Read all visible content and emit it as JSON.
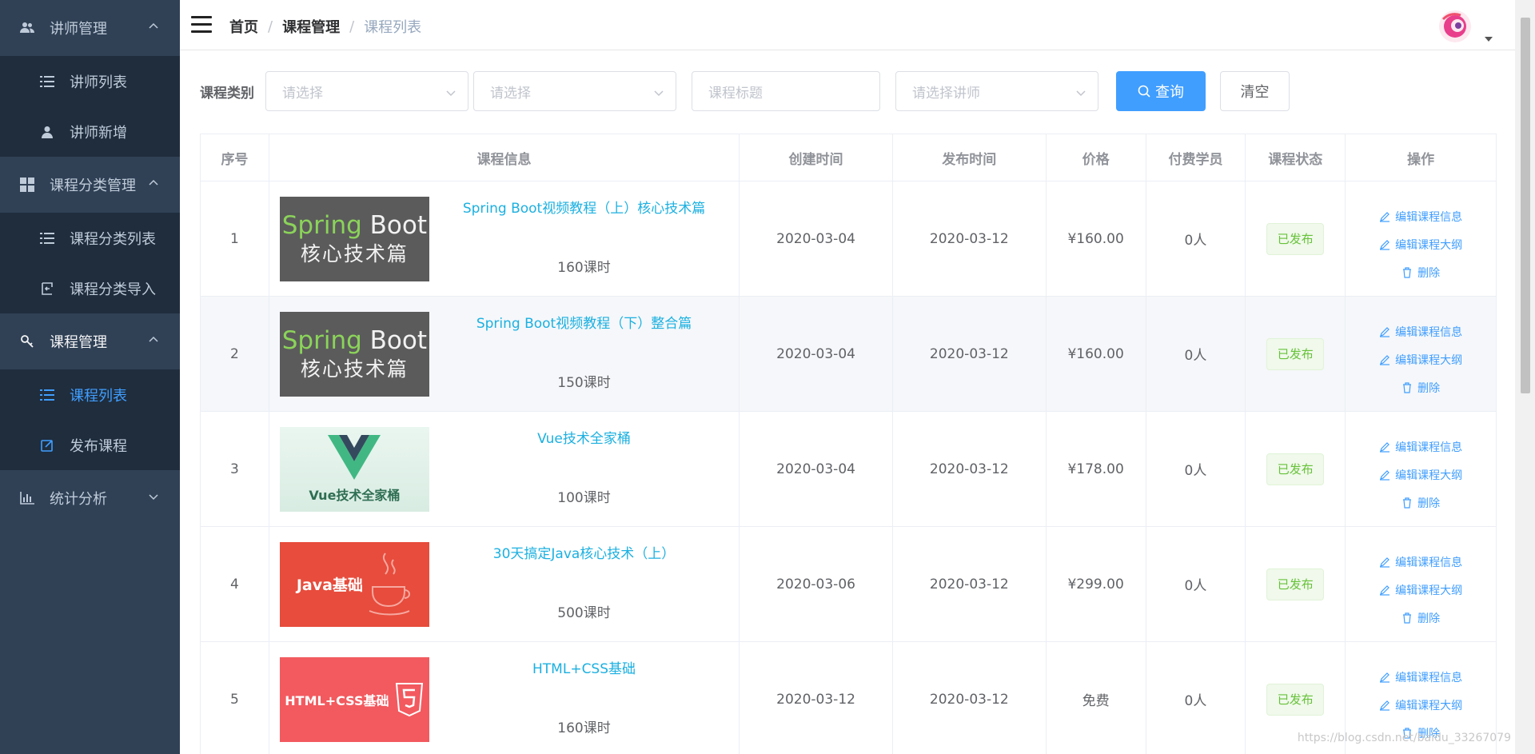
{
  "sidebar": {
    "groups": [
      {
        "label": "讲师管理",
        "icon": "users-icon",
        "expanded": true,
        "items": [
          {
            "label": "讲师列表",
            "icon": "list-icon"
          },
          {
            "label": "讲师新增",
            "icon": "user-icon"
          }
        ]
      },
      {
        "label": "课程分类管理",
        "icon": "grid-icon",
        "expanded": true,
        "items": [
          {
            "label": "课程分类列表",
            "icon": "list-icon"
          },
          {
            "label": "课程分类导入",
            "icon": "import-icon"
          }
        ]
      },
      {
        "label": "课程管理",
        "icon": "key-icon",
        "expanded": true,
        "items": [
          {
            "label": "课程列表",
            "icon": "list-icon",
            "active": true
          },
          {
            "label": "发布课程",
            "icon": "edit-icon"
          }
        ]
      },
      {
        "label": "统计分析",
        "icon": "chart-icon",
        "expanded": false,
        "items": []
      }
    ]
  },
  "header": {
    "breadcrumb": [
      "首页",
      "课程管理",
      "课程列表"
    ]
  },
  "filters": {
    "label": "课程类别",
    "select1_placeholder": "请选择",
    "select2_placeholder": "请选择",
    "title_placeholder": "课程标题",
    "teacher_placeholder": "请选择讲师",
    "search_label": "查询",
    "clear_label": "清空"
  },
  "table": {
    "columns": [
      "序号",
      "课程信息",
      "创建时间",
      "发布时间",
      "价格",
      "付费学员",
      "课程状态",
      "操作"
    ],
    "ops": {
      "edit_info": "编辑课程信息",
      "edit_outline": "编辑课程大纲",
      "delete": "删除"
    },
    "rows": [
      {
        "index": "1",
        "title": "Spring Boot视频教程（上）核心技术篇",
        "hours": "160课时",
        "created": "2020-03-04",
        "published": "2020-03-12",
        "price": "¥160.00",
        "students": "0人",
        "status": "已发布",
        "cover": {
          "type": "springboot",
          "line1a": "Spring",
          "line1b": " Boot",
          "line2": "核心技术篇"
        }
      },
      {
        "index": "2",
        "title": "Spring Boot视频教程（下）整合篇",
        "hours": "150课时",
        "created": "2020-03-04",
        "published": "2020-03-12",
        "price": "¥160.00",
        "students": "0人",
        "status": "已发布",
        "cover": {
          "type": "springboot",
          "line1a": "Spring",
          "line1b": " Boot",
          "line2": "核心技术篇"
        }
      },
      {
        "index": "3",
        "title": "Vue技术全家桶",
        "hours": "100课时",
        "created": "2020-03-04",
        "published": "2020-03-12",
        "price": "¥178.00",
        "students": "0人",
        "status": "已发布",
        "cover": {
          "type": "vue",
          "text": "Vue技术全家桶"
        }
      },
      {
        "index": "4",
        "title": "30天搞定Java核心技术（上）",
        "hours": "500课时",
        "created": "2020-03-06",
        "published": "2020-03-12",
        "price": "¥299.00",
        "students": "0人",
        "status": "已发布",
        "cover": {
          "type": "java",
          "text": "Java基础"
        }
      },
      {
        "index": "5",
        "title": "HTML+CSS基础",
        "hours": "160课时",
        "created": "2020-03-12",
        "published": "2020-03-12",
        "price": "免费",
        "students": "0人",
        "status": "已发布",
        "cover": {
          "type": "html",
          "text": "HTML+CSS基础"
        }
      }
    ]
  },
  "watermark": "https://blog.csdn.net/baidu_33267079",
  "colors": {
    "sidebar_bg": "#304156",
    "submenu_bg": "#1f2d3d",
    "primary": "#409eff",
    "link": "#1cb0e0",
    "success": "#67c23a"
  }
}
